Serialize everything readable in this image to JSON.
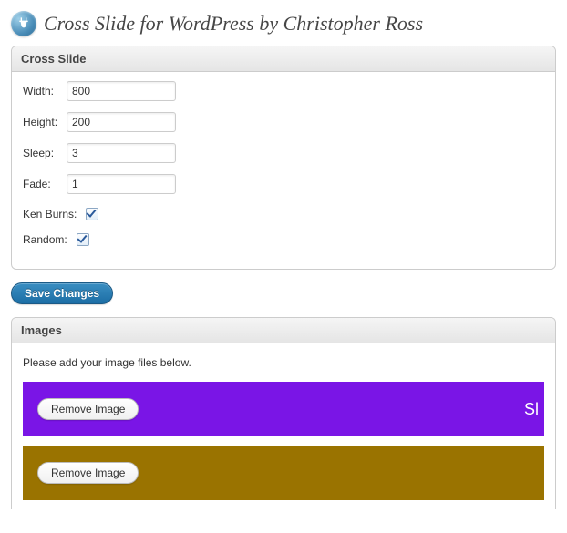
{
  "page": {
    "title": "Cross Slide for WordPress by Christopher Ross"
  },
  "settings_panel": {
    "title": "Cross Slide",
    "fields": {
      "width": {
        "label": "Width:",
        "value": "800"
      },
      "height": {
        "label": "Height:",
        "value": "200"
      },
      "sleep": {
        "label": "Sleep:",
        "value": "3"
      },
      "fade": {
        "label": "Fade:",
        "value": "1"
      }
    },
    "checks": {
      "ken_burns": {
        "label": "Ken Burns:",
        "checked": true
      },
      "random": {
        "label": "Random:",
        "checked": true
      }
    }
  },
  "save_button_label": "Save Changes",
  "images_panel": {
    "title": "Images",
    "help_text": "Please add your image files below.",
    "remove_label": "Remove Image",
    "slot1_fragment": "Sl"
  }
}
